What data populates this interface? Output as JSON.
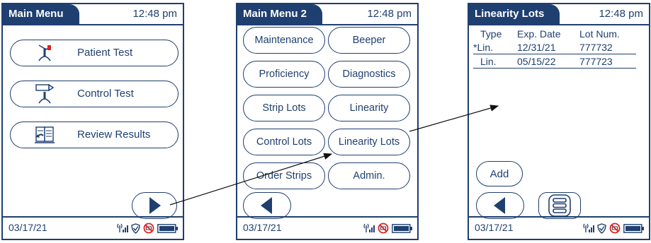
{
  "screens": [
    {
      "title": "Main Menu",
      "time": "12:48 pm",
      "date": "03/17/21",
      "buttons": [
        {
          "label": "Patient Test",
          "icon": "patient-test-icon"
        },
        {
          "label": "Control Test",
          "icon": "control-test-icon"
        },
        {
          "label": "Review Results",
          "icon": "review-results-icon"
        }
      ],
      "status_icons": [
        "signal-icon",
        "shield-icon",
        "no-connection-icon",
        "battery-icon"
      ]
    },
    {
      "title": "Main Menu 2",
      "time": "12:48 pm",
      "date": "03/17/21",
      "buttons": [
        "Maintenance",
        "Beeper",
        "Proficiency",
        "Diagnostics",
        "Strip Lots",
        "Linearity",
        "Control Lots",
        "Linearity Lots",
        "Order Strips",
        "Admin."
      ],
      "status_icons": [
        "signal-icon",
        "no-connection-icon",
        "battery-icon"
      ]
    },
    {
      "title": "Linearity Lots",
      "time": "12:48 pm",
      "date": "03/17/21",
      "columns": [
        "Type",
        "Exp. Date",
        "Lot Num."
      ],
      "rows": [
        {
          "marker": "*",
          "type": "Lin.",
          "exp": "12/31/21",
          "lot": "777732"
        },
        {
          "marker": "",
          "type": "Lin.",
          "exp": "05/15/22",
          "lot": "777723"
        }
      ],
      "add_label": "Add",
      "status_icons": [
        "signal-icon",
        "shield-icon",
        "no-connection-icon",
        "battery-icon"
      ]
    }
  ],
  "colors": {
    "primary": "#1f3f70",
    "background": "#ffffff",
    "accent_red": "#e0201c"
  }
}
